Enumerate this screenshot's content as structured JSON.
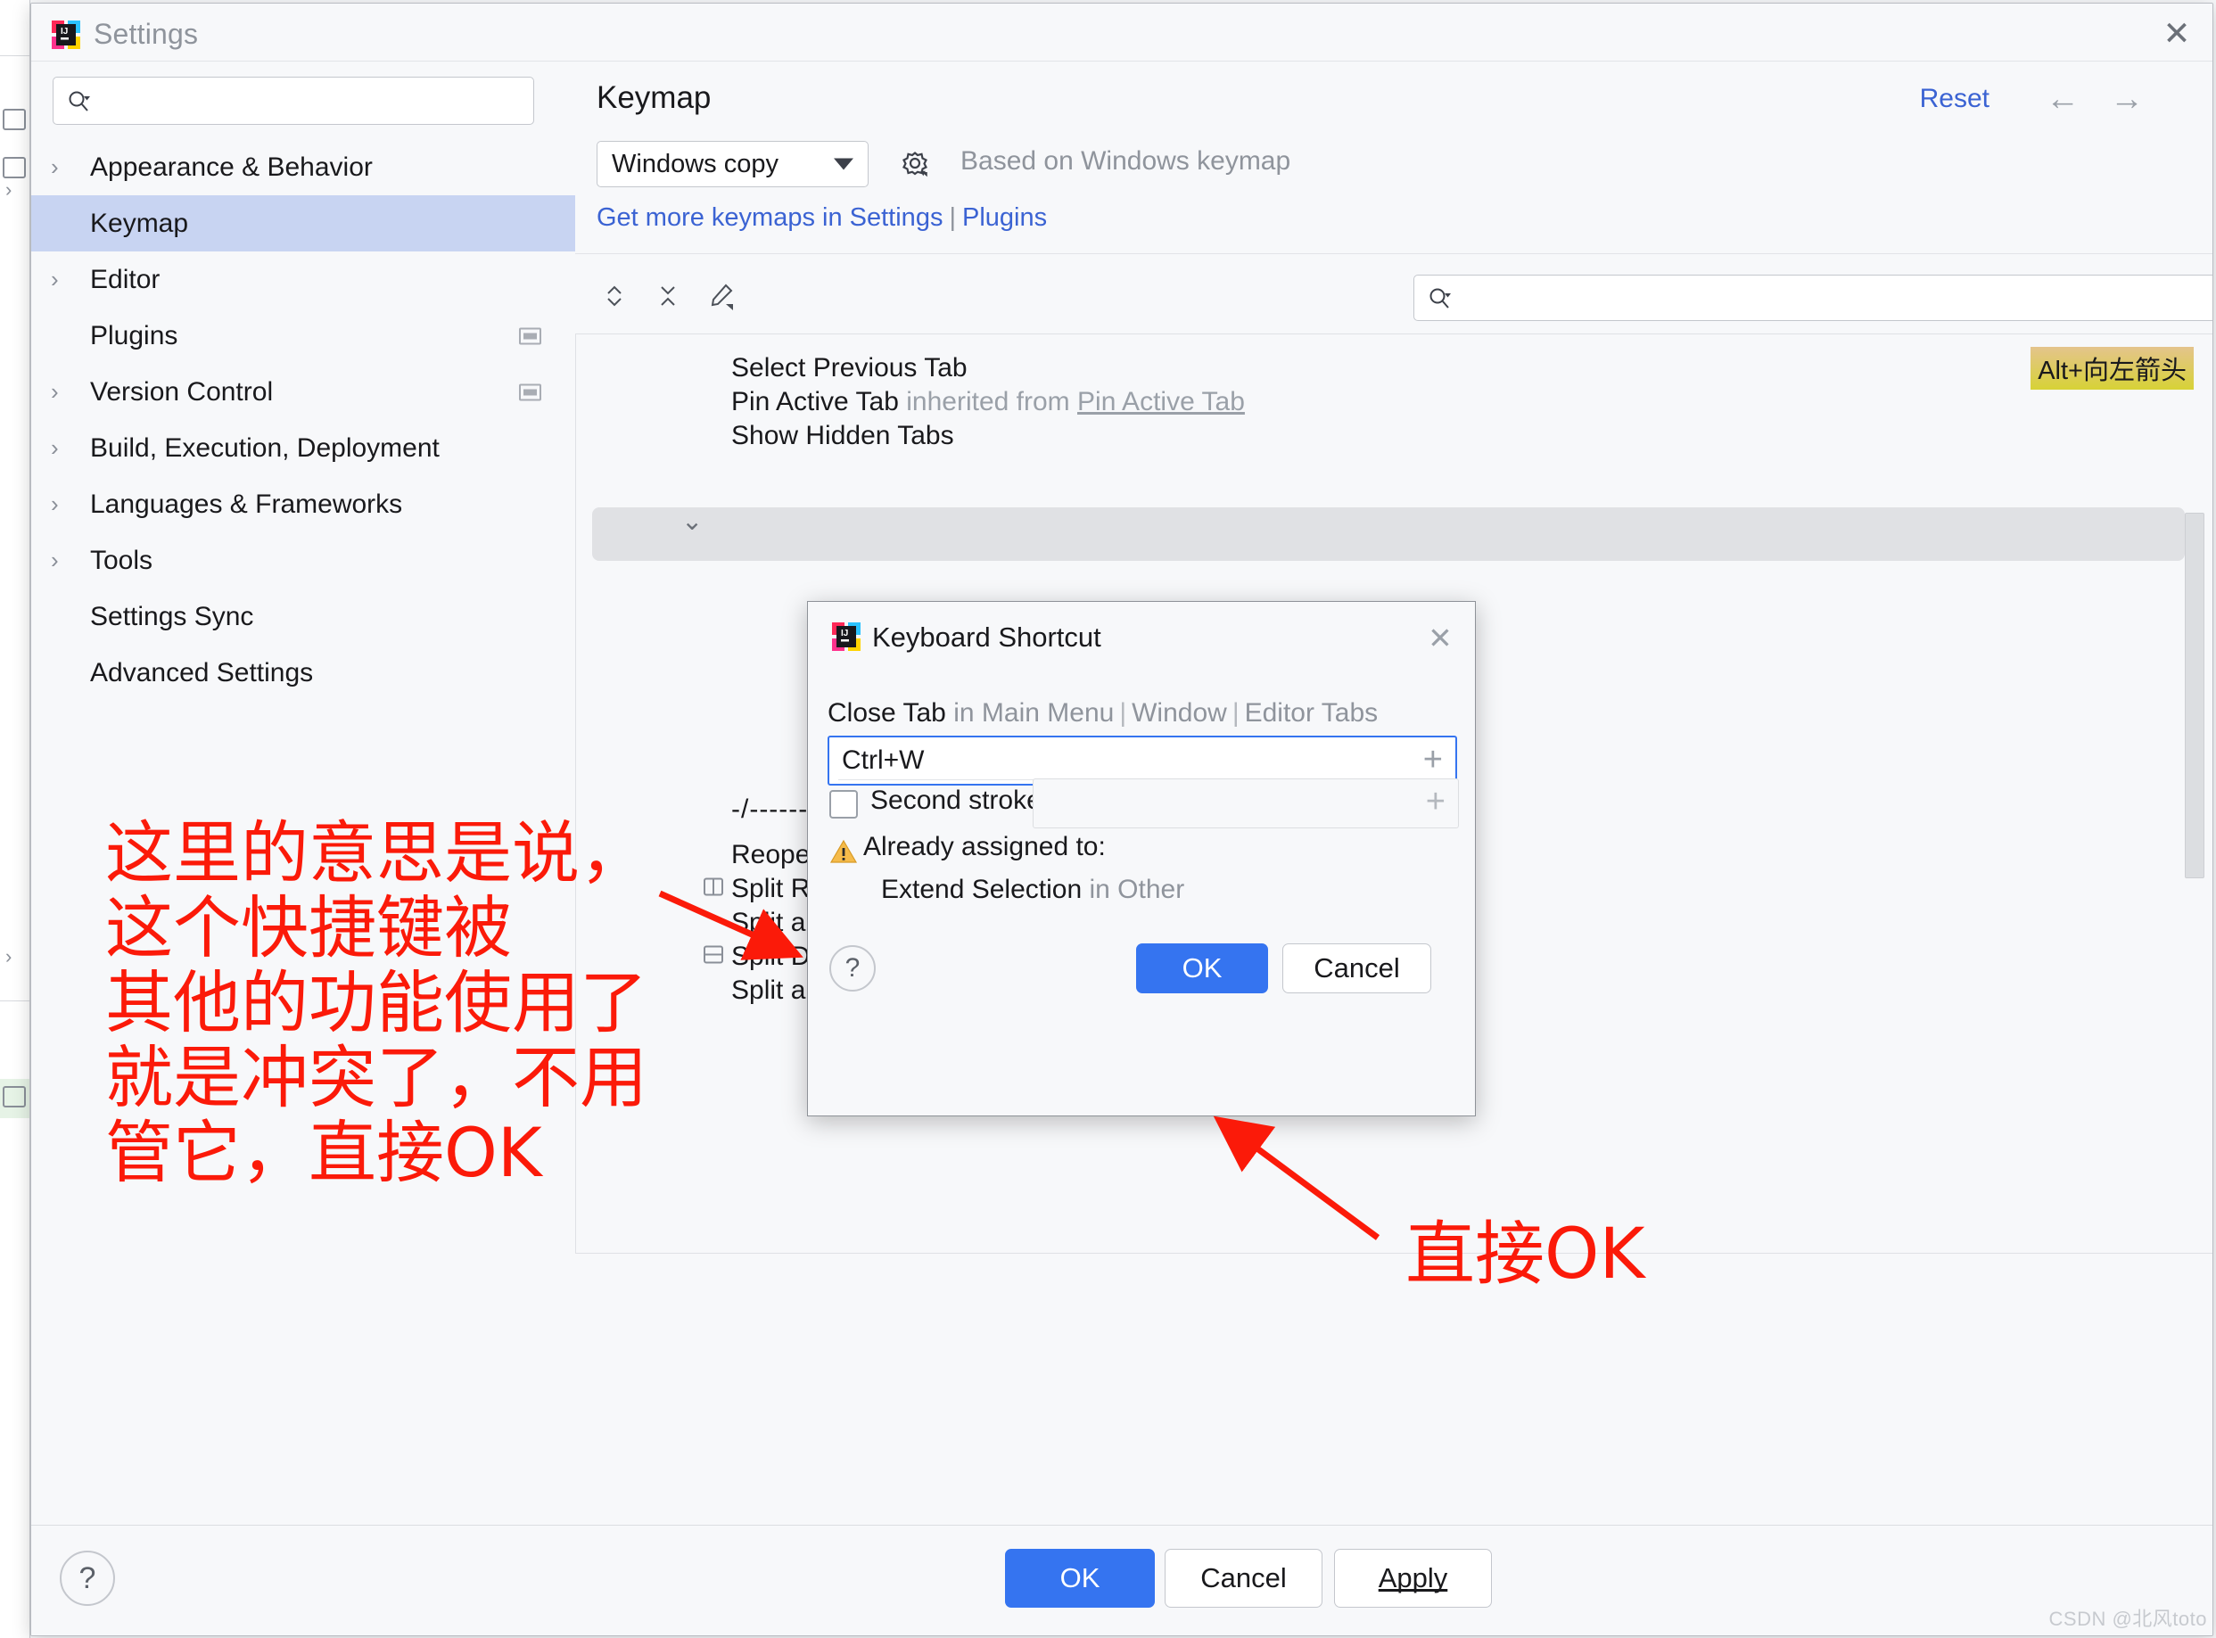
{
  "window": {
    "title": "Settings",
    "close_icon": "close-icon",
    "app_icon": "intellij-idea-logo"
  },
  "sidebar": {
    "search_placeholder": "",
    "search_value": "",
    "search_icon": "search-icon",
    "items": [
      {
        "label": "Appearance & Behavior",
        "chevron": "›",
        "selected": false,
        "mark": false
      },
      {
        "label": "Keymap",
        "chevron": "",
        "selected": true,
        "mark": false
      },
      {
        "label": "Editor",
        "chevron": "›",
        "selected": false,
        "mark": false
      },
      {
        "label": "Plugins",
        "chevron": "",
        "selected": false,
        "mark": true
      },
      {
        "label": "Version Control",
        "chevron": "›",
        "selected": false,
        "mark": true
      },
      {
        "label": "Build, Execution, Deployment",
        "chevron": "›",
        "selected": false,
        "mark": false
      },
      {
        "label": "Languages & Frameworks",
        "chevron": "›",
        "selected": false,
        "mark": false
      },
      {
        "label": "Tools",
        "chevron": "›",
        "selected": false,
        "mark": false
      },
      {
        "label": "Settings Sync",
        "chevron": "",
        "selected": false,
        "mark": false
      },
      {
        "label": "Advanced Settings",
        "chevron": "",
        "selected": false,
        "mark": false
      }
    ]
  },
  "keymap_page": {
    "heading": "Keymap",
    "reset_label": "Reset",
    "back_icon": "arrow-left-icon",
    "forward_icon": "arrow-right-icon",
    "keymap_select_value": "Windows copy",
    "gear_icon": "gear-icon",
    "based_on": "Based on Windows keymap",
    "get_more_text": "Get more keymaps in Settings",
    "get_more_sep": "|",
    "plugins_link": "Plugins",
    "toolbar": {
      "expand_all_icon": "expand-all-icon",
      "collapse_all_icon": "collapse-all-icon",
      "edit_shortcut_icon": "edit-pencil-icon",
      "filter_icon": "find-shortcut-icon"
    },
    "list_search_value": "",
    "list_search_placeholder": "",
    "list_search_icon": "search-icon",
    "rows": [
      {
        "label": "Select Previous Tab",
        "suffix": "",
        "suffix_underline": "",
        "shortcut": "Alt+向左箭头",
        "icon": ""
      },
      {
        "label": "Pin Active Tab",
        "suffix": "inherited from",
        "suffix_underline": "Pin Active Tab",
        "shortcut": "",
        "icon": ""
      },
      {
        "label": "Show Hidden Tabs",
        "suffix": "",
        "suffix_underline": "",
        "shortcut": "",
        "icon": ""
      },
      {
        "label": "Reopen Closed Tab",
        "suffix": "",
        "suffix_underline": "",
        "shortcut": "",
        "icon": ""
      },
      {
        "label": "Split Right",
        "suffix": "",
        "suffix_underline": "",
        "shortcut": "",
        "icon": "split-right-icon"
      },
      {
        "label": "Split and Move Right",
        "suffix": "",
        "suffix_underline": "",
        "shortcut": "",
        "icon": ""
      },
      {
        "label": "Split Down",
        "suffix": "",
        "suffix_underline": "",
        "shortcut": "",
        "icon": "split-down-icon"
      },
      {
        "label": "Split and Move Down",
        "suffix": "",
        "suffix_underline": "",
        "shortcut": "",
        "icon": ""
      }
    ],
    "separator_row": "-/-----------"
  },
  "dialog": {
    "title": "Keyboard Shortcut",
    "app_icon": "intellij-idea-logo",
    "close_icon": "close-icon",
    "action_name": "Close Tab",
    "action_context_prefix": "in Main Menu",
    "action_context_2": "Window",
    "action_context_3": "Editor Tabs",
    "first_stroke_value": "Ctrl+W",
    "first_stroke_add_icon": "plus-icon",
    "second_stroke_label": "Second stroke:",
    "second_stroke_value": "",
    "second_stroke_checked": false,
    "second_stroke_add_icon": "plus-icon",
    "warning_icon": "warning-triangle-icon",
    "warning_title": "Already assigned to:",
    "warning_detail_action": "Extend Selection",
    "warning_detail_scope": "in Other",
    "help_label": "?",
    "ok_label": "OK",
    "cancel_label": "Cancel"
  },
  "footer": {
    "help_label": "?",
    "ok_label": "OK",
    "cancel_label": "Cancel",
    "apply_label": "Apply",
    "watermark": "CSDN @北风toto"
  },
  "annotations": {
    "left_note": "这里的意思是说，\n这个快捷键被\n其他的功能使用了\n就是冲突了，不用\n管它，直接OK",
    "right_note": "直接OK",
    "color": "#fb1a09"
  }
}
